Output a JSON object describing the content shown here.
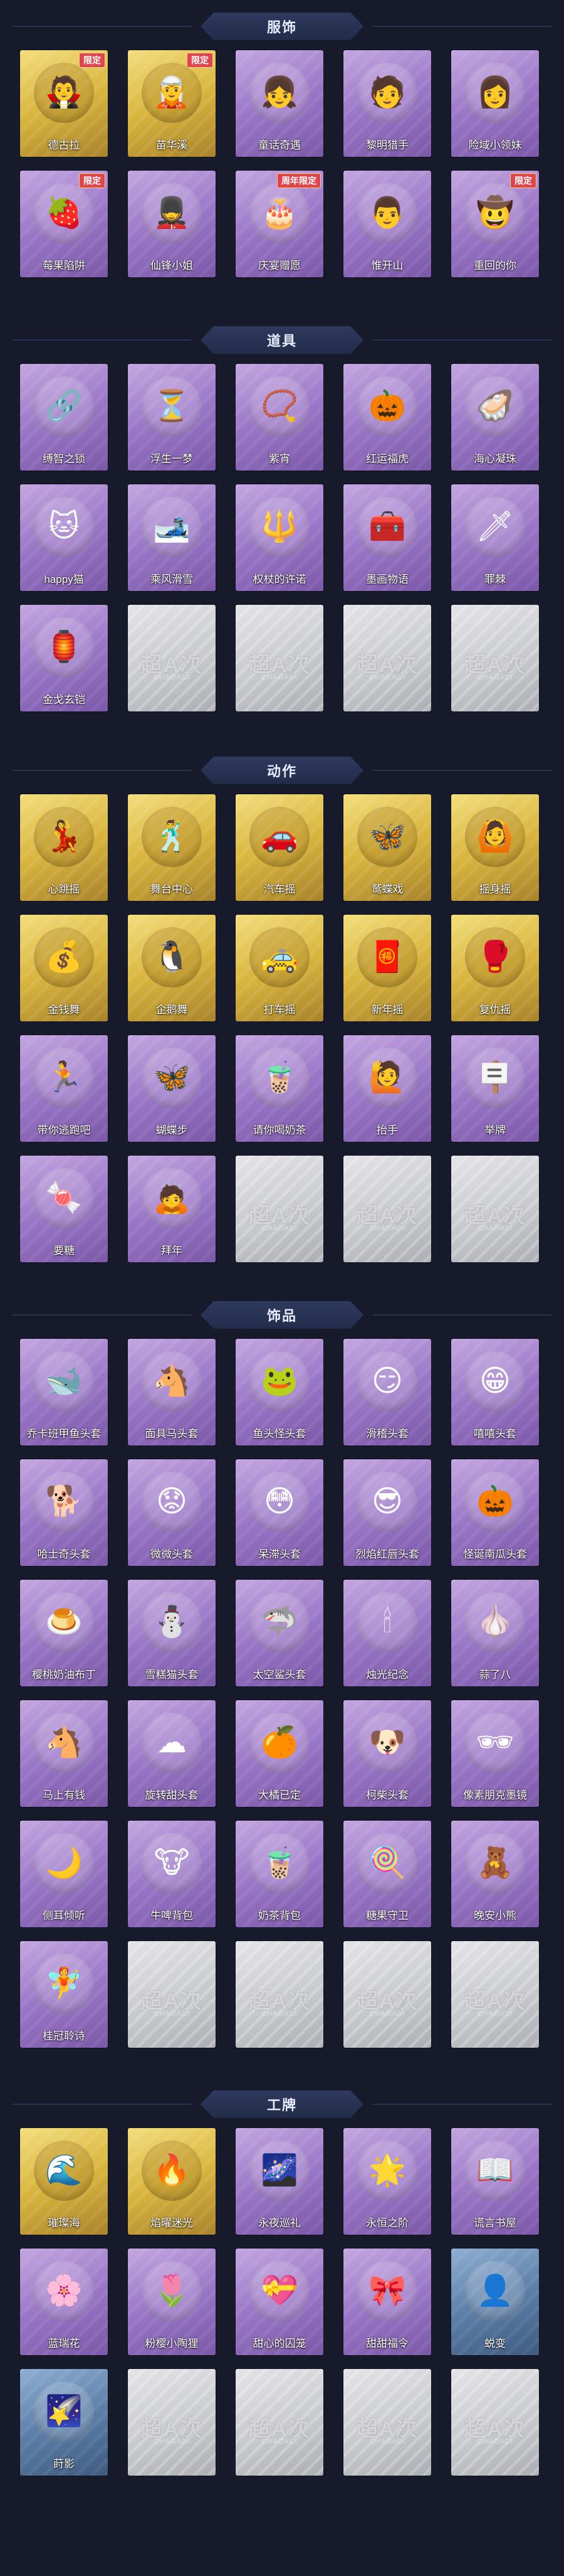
{
  "watermark": {
    "text": "超A次",
    "sub": "CHAOACI"
  },
  "sections": [
    {
      "id": "costumes",
      "title": "服饰",
      "items": [
        {
          "label": "德古拉",
          "style": "gold",
          "icon": "🧛",
          "badge": "限定"
        },
        {
          "label": "苗华溪",
          "style": "gold",
          "icon": "🧝",
          "badge": "限定"
        },
        {
          "label": "童话奇遇",
          "style": "purple",
          "icon": "👧",
          "badge": ""
        },
        {
          "label": "黎明猎手",
          "style": "purple",
          "icon": "🧑",
          "badge": ""
        },
        {
          "label": "险域小领妹",
          "style": "purple",
          "icon": "👩",
          "badge": ""
        },
        {
          "label": "莓果陷阱",
          "style": "purple",
          "icon": "🍓",
          "badge": "限定"
        },
        {
          "label": "仙锋小姐",
          "style": "purple",
          "icon": "💂",
          "badge": ""
        },
        {
          "label": "庆宴赠愿",
          "style": "purple",
          "icon": "🎂",
          "badge": "周年限定"
        },
        {
          "label": "惟开山",
          "style": "purple",
          "icon": "👨",
          "badge": ""
        },
        {
          "label": "重回的你",
          "style": "purple",
          "icon": "🤠",
          "badge": "限定"
        }
      ]
    },
    {
      "id": "props",
      "title": "道具",
      "items": [
        {
          "label": "缚智之锁",
          "style": "purple",
          "icon": "🔗",
          "badge": ""
        },
        {
          "label": "浮生一梦",
          "style": "purple",
          "icon": "⏳",
          "badge": ""
        },
        {
          "label": "紫宵",
          "style": "purple",
          "icon": "📿",
          "badge": ""
        },
        {
          "label": "红运福虎",
          "style": "purple",
          "icon": "🎃",
          "badge": ""
        },
        {
          "label": "海心凝珠",
          "style": "purple",
          "icon": "🦪",
          "badge": ""
        },
        {
          "label": "happy猫",
          "style": "purple",
          "icon": "🐱",
          "badge": ""
        },
        {
          "label": "乘风滑雪",
          "style": "purple",
          "icon": "🎿",
          "badge": ""
        },
        {
          "label": "权杖的许诺",
          "style": "purple",
          "icon": "🔱",
          "badge": ""
        },
        {
          "label": "墨画物语",
          "style": "purple",
          "icon": "🧰",
          "badge": ""
        },
        {
          "label": "罪棘",
          "style": "purple",
          "icon": "🗡",
          "badge": ""
        },
        {
          "label": "金戈玄铠",
          "style": "purple",
          "icon": "🏮",
          "badge": ""
        },
        {
          "label": "",
          "style": "empty",
          "icon": "",
          "badge": ""
        },
        {
          "label": "",
          "style": "empty",
          "icon": "",
          "badge": ""
        },
        {
          "label": "",
          "style": "empty",
          "icon": "",
          "badge": ""
        },
        {
          "label": "",
          "style": "empty",
          "icon": "",
          "badge": ""
        }
      ]
    },
    {
      "id": "actions",
      "title": "动作",
      "items": [
        {
          "label": "心跳摇",
          "style": "gold",
          "icon": "💃",
          "badge": ""
        },
        {
          "label": "舞台中心",
          "style": "gold",
          "icon": "🕺",
          "badge": ""
        },
        {
          "label": "汽车摇",
          "style": "gold",
          "icon": "🚗",
          "badge": ""
        },
        {
          "label": "鹫蝶戏",
          "style": "gold",
          "icon": "🦋",
          "badge": ""
        },
        {
          "label": "摇身摇",
          "style": "gold",
          "icon": "🙆",
          "badge": ""
        },
        {
          "label": "金钱舞",
          "style": "gold",
          "icon": "💰",
          "badge": ""
        },
        {
          "label": "企鹅舞",
          "style": "gold",
          "icon": "🐧",
          "badge": ""
        },
        {
          "label": "打车摇",
          "style": "gold",
          "icon": "🚕",
          "badge": ""
        },
        {
          "label": "新年摇",
          "style": "gold",
          "icon": "🧧",
          "badge": ""
        },
        {
          "label": "复仇摇",
          "style": "gold",
          "icon": "🥊",
          "badge": ""
        },
        {
          "label": "带你逃跑吧",
          "style": "purple",
          "icon": "🏃",
          "badge": ""
        },
        {
          "label": "蝴蝶步",
          "style": "purple",
          "icon": "🦋",
          "badge": ""
        },
        {
          "label": "请你喝奶茶",
          "style": "purple",
          "icon": "🧋",
          "badge": ""
        },
        {
          "label": "抬手",
          "style": "purple",
          "icon": "🙋",
          "badge": ""
        },
        {
          "label": "举牌",
          "style": "purple",
          "icon": "🪧",
          "badge": ""
        },
        {
          "label": "要糖",
          "style": "purple",
          "icon": "🍬",
          "badge": ""
        },
        {
          "label": "拜年",
          "style": "purple",
          "icon": "🙇",
          "badge": ""
        },
        {
          "label": "",
          "style": "empty",
          "icon": "",
          "badge": ""
        },
        {
          "label": "",
          "style": "empty",
          "icon": "",
          "badge": ""
        },
        {
          "label": "",
          "style": "empty",
          "icon": "",
          "badge": ""
        }
      ]
    },
    {
      "id": "accessories",
      "title": "饰品",
      "items": [
        {
          "label": "乔卡班甲鱼头套",
          "style": "purple",
          "icon": "🐋",
          "badge": ""
        },
        {
          "label": "面具马头套",
          "style": "purple",
          "icon": "🐴",
          "badge": ""
        },
        {
          "label": "鱼头怪头套",
          "style": "purple",
          "icon": "🐸",
          "badge": ""
        },
        {
          "label": "滑稽头套",
          "style": "purple",
          "icon": "😏",
          "badge": ""
        },
        {
          "label": "嘻嘻头套",
          "style": "purple",
          "icon": "😁",
          "badge": ""
        },
        {
          "label": "哈士奇头套",
          "style": "purple",
          "icon": "🐕",
          "badge": ""
        },
        {
          "label": "微微头套",
          "style": "purple",
          "icon": "😟",
          "badge": ""
        },
        {
          "label": "呆滞头套",
          "style": "purple",
          "icon": "😳",
          "badge": ""
        },
        {
          "label": "烈焰红唇头套",
          "style": "purple",
          "icon": "😎",
          "badge": ""
        },
        {
          "label": "怪诞南瓜头套",
          "style": "purple",
          "icon": "🎃",
          "badge": ""
        },
        {
          "label": "樱桃奶油布丁",
          "style": "purple",
          "icon": "🍮",
          "badge": ""
        },
        {
          "label": "雪糕猫头套",
          "style": "purple",
          "icon": "⛄",
          "badge": ""
        },
        {
          "label": "太空鲨头套",
          "style": "purple",
          "icon": "🦈",
          "badge": ""
        },
        {
          "label": "烛光纪念",
          "style": "purple",
          "icon": "🕯",
          "badge": ""
        },
        {
          "label": "蒜了八",
          "style": "purple",
          "icon": "🧄",
          "badge": ""
        },
        {
          "label": "马上有钱",
          "style": "purple",
          "icon": "🐴",
          "badge": ""
        },
        {
          "label": "旋转甜头套",
          "style": "purple",
          "icon": "☁",
          "badge": ""
        },
        {
          "label": "大橘已定",
          "style": "purple",
          "icon": "🍊",
          "badge": ""
        },
        {
          "label": "柯柴头套",
          "style": "purple",
          "icon": "🐶",
          "badge": ""
        },
        {
          "label": "像素朋克墨镜",
          "style": "purple",
          "icon": "🕶",
          "badge": ""
        },
        {
          "label": "侧耳倾听",
          "style": "purple",
          "icon": "🌙",
          "badge": ""
        },
        {
          "label": "牛啤背包",
          "style": "purple",
          "icon": "🐮",
          "badge": ""
        },
        {
          "label": "奶茶背包",
          "style": "purple",
          "icon": "🧋",
          "badge": ""
        },
        {
          "label": "糖果守卫",
          "style": "purple",
          "icon": "🍭",
          "badge": ""
        },
        {
          "label": "晚安小熊",
          "style": "purple",
          "icon": "🧸",
          "badge": ""
        },
        {
          "label": "桂冠聆诗",
          "style": "purple",
          "icon": "🧚",
          "badge": ""
        },
        {
          "label": "",
          "style": "empty",
          "icon": "",
          "badge": ""
        },
        {
          "label": "",
          "style": "empty",
          "icon": "",
          "badge": ""
        },
        {
          "label": "",
          "style": "empty",
          "icon": "",
          "badge": ""
        },
        {
          "label": "",
          "style": "empty",
          "icon": "",
          "badge": ""
        }
      ]
    },
    {
      "id": "badges",
      "title": "工牌",
      "items": [
        {
          "label": "璀璨海",
          "style": "gold",
          "icon": "🌊",
          "badge": ""
        },
        {
          "label": "焰曜迷光",
          "style": "gold",
          "icon": "🔥",
          "badge": ""
        },
        {
          "label": "永夜巡礼",
          "style": "purple",
          "icon": "🌌",
          "badge": ""
        },
        {
          "label": "永恒之阶",
          "style": "purple",
          "icon": "🌟",
          "badge": ""
        },
        {
          "label": "谎言书屋",
          "style": "purple",
          "icon": "📖",
          "badge": ""
        },
        {
          "label": "蓝瑞花",
          "style": "purple",
          "icon": "🌸",
          "badge": ""
        },
        {
          "label": "粉樱小陶狸",
          "style": "purple",
          "icon": "🌷",
          "badge": ""
        },
        {
          "label": "甜心的囚笼",
          "style": "purple",
          "icon": "💝",
          "badge": ""
        },
        {
          "label": "甜甜福令",
          "style": "purple",
          "icon": "🎀",
          "badge": ""
        },
        {
          "label": "蜕变",
          "style": "blue",
          "icon": "👤",
          "badge": ""
        },
        {
          "label": "莳影",
          "style": "blue",
          "icon": "🌠",
          "badge": ""
        },
        {
          "label": "",
          "style": "empty",
          "icon": "",
          "badge": ""
        },
        {
          "label": "",
          "style": "empty",
          "icon": "",
          "badge": ""
        },
        {
          "label": "",
          "style": "empty",
          "icon": "",
          "badge": ""
        },
        {
          "label": "",
          "style": "empty",
          "icon": "",
          "badge": ""
        }
      ]
    }
  ]
}
